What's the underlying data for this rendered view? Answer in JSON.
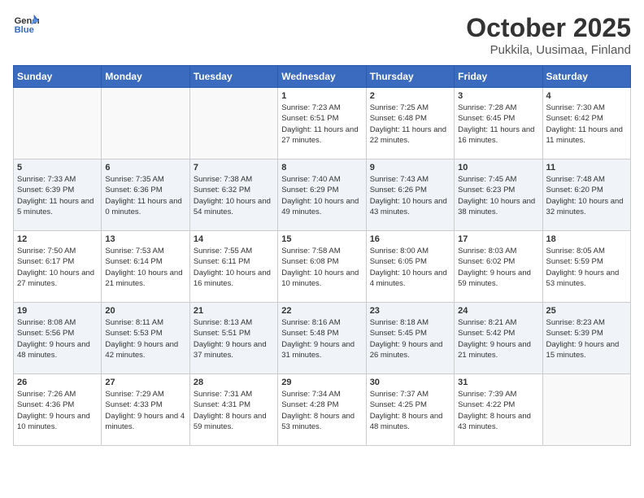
{
  "header": {
    "logo_general": "General",
    "logo_blue": "Blue",
    "month_title": "October 2025",
    "location": "Pukkila, Uusimaa, Finland"
  },
  "weekdays": [
    "Sunday",
    "Monday",
    "Tuesday",
    "Wednesday",
    "Thursday",
    "Friday",
    "Saturday"
  ],
  "weeks": [
    [
      {
        "day": "",
        "info": ""
      },
      {
        "day": "",
        "info": ""
      },
      {
        "day": "",
        "info": ""
      },
      {
        "day": "1",
        "info": "Sunrise: 7:23 AM\nSunset: 6:51 PM\nDaylight: 11 hours and 27 minutes."
      },
      {
        "day": "2",
        "info": "Sunrise: 7:25 AM\nSunset: 6:48 PM\nDaylight: 11 hours and 22 minutes."
      },
      {
        "day": "3",
        "info": "Sunrise: 7:28 AM\nSunset: 6:45 PM\nDaylight: 11 hours and 16 minutes."
      },
      {
        "day": "4",
        "info": "Sunrise: 7:30 AM\nSunset: 6:42 PM\nDaylight: 11 hours and 11 minutes."
      }
    ],
    [
      {
        "day": "5",
        "info": "Sunrise: 7:33 AM\nSunset: 6:39 PM\nDaylight: 11 hours and 5 minutes."
      },
      {
        "day": "6",
        "info": "Sunrise: 7:35 AM\nSunset: 6:36 PM\nDaylight: 11 hours and 0 minutes."
      },
      {
        "day": "7",
        "info": "Sunrise: 7:38 AM\nSunset: 6:32 PM\nDaylight: 10 hours and 54 minutes."
      },
      {
        "day": "8",
        "info": "Sunrise: 7:40 AM\nSunset: 6:29 PM\nDaylight: 10 hours and 49 minutes."
      },
      {
        "day": "9",
        "info": "Sunrise: 7:43 AM\nSunset: 6:26 PM\nDaylight: 10 hours and 43 minutes."
      },
      {
        "day": "10",
        "info": "Sunrise: 7:45 AM\nSunset: 6:23 PM\nDaylight: 10 hours and 38 minutes."
      },
      {
        "day": "11",
        "info": "Sunrise: 7:48 AM\nSunset: 6:20 PM\nDaylight: 10 hours and 32 minutes."
      }
    ],
    [
      {
        "day": "12",
        "info": "Sunrise: 7:50 AM\nSunset: 6:17 PM\nDaylight: 10 hours and 27 minutes."
      },
      {
        "day": "13",
        "info": "Sunrise: 7:53 AM\nSunset: 6:14 PM\nDaylight: 10 hours and 21 minutes."
      },
      {
        "day": "14",
        "info": "Sunrise: 7:55 AM\nSunset: 6:11 PM\nDaylight: 10 hours and 16 minutes."
      },
      {
        "day": "15",
        "info": "Sunrise: 7:58 AM\nSunset: 6:08 PM\nDaylight: 10 hours and 10 minutes."
      },
      {
        "day": "16",
        "info": "Sunrise: 8:00 AM\nSunset: 6:05 PM\nDaylight: 10 hours and 4 minutes."
      },
      {
        "day": "17",
        "info": "Sunrise: 8:03 AM\nSunset: 6:02 PM\nDaylight: 9 hours and 59 minutes."
      },
      {
        "day": "18",
        "info": "Sunrise: 8:05 AM\nSunset: 5:59 PM\nDaylight: 9 hours and 53 minutes."
      }
    ],
    [
      {
        "day": "19",
        "info": "Sunrise: 8:08 AM\nSunset: 5:56 PM\nDaylight: 9 hours and 48 minutes."
      },
      {
        "day": "20",
        "info": "Sunrise: 8:11 AM\nSunset: 5:53 PM\nDaylight: 9 hours and 42 minutes."
      },
      {
        "day": "21",
        "info": "Sunrise: 8:13 AM\nSunset: 5:51 PM\nDaylight: 9 hours and 37 minutes."
      },
      {
        "day": "22",
        "info": "Sunrise: 8:16 AM\nSunset: 5:48 PM\nDaylight: 9 hours and 31 minutes."
      },
      {
        "day": "23",
        "info": "Sunrise: 8:18 AM\nSunset: 5:45 PM\nDaylight: 9 hours and 26 minutes."
      },
      {
        "day": "24",
        "info": "Sunrise: 8:21 AM\nSunset: 5:42 PM\nDaylight: 9 hours and 21 minutes."
      },
      {
        "day": "25",
        "info": "Sunrise: 8:23 AM\nSunset: 5:39 PM\nDaylight: 9 hours and 15 minutes."
      }
    ],
    [
      {
        "day": "26",
        "info": "Sunrise: 7:26 AM\nSunset: 4:36 PM\nDaylight: 9 hours and 10 minutes."
      },
      {
        "day": "27",
        "info": "Sunrise: 7:29 AM\nSunset: 4:33 PM\nDaylight: 9 hours and 4 minutes."
      },
      {
        "day": "28",
        "info": "Sunrise: 7:31 AM\nSunset: 4:31 PM\nDaylight: 8 hours and 59 minutes."
      },
      {
        "day": "29",
        "info": "Sunrise: 7:34 AM\nSunset: 4:28 PM\nDaylight: 8 hours and 53 minutes."
      },
      {
        "day": "30",
        "info": "Sunrise: 7:37 AM\nSunset: 4:25 PM\nDaylight: 8 hours and 48 minutes."
      },
      {
        "day": "31",
        "info": "Sunrise: 7:39 AM\nSunset: 4:22 PM\nDaylight: 8 hours and 43 minutes."
      },
      {
        "day": "",
        "info": ""
      }
    ]
  ]
}
